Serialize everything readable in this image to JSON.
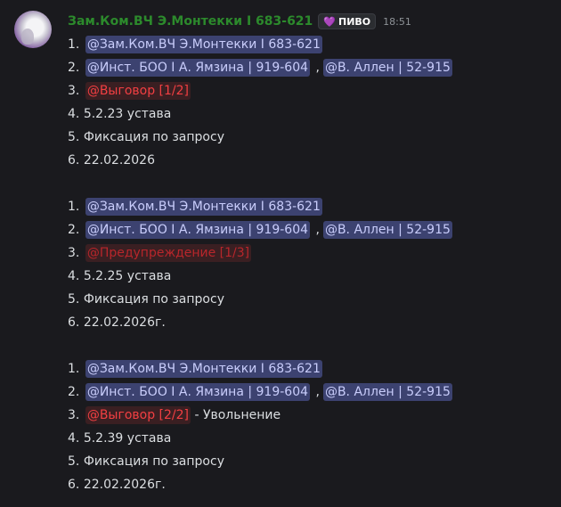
{
  "author": {
    "name": "Зам.Ком.ВЧ Э.Монтекки I 683-621",
    "badge_icon": "heart-icon",
    "badge_label": "ПИВО",
    "time": "18:51",
    "name_color": "#2c8a2c"
  },
  "blocks": [
    {
      "l1": {
        "num": "1.",
        "m1": "@Зам.Ком.ВЧ Э.Монтекки I 683-621"
      },
      "l2": {
        "num": "2.",
        "m1": "@Инст. БОО I А. Ямзина | 919-604",
        "sep": ",",
        "m2": "@В. Аллен | 52-915"
      },
      "l3": {
        "num": "3.",
        "m1": "@Выговор [1/2]",
        "suffix": ""
      },
      "l4": {
        "num": "4.",
        "text": "5.2.23 устава"
      },
      "l5": {
        "num": "5.",
        "text": "Фиксация по запросу"
      },
      "l6": {
        "num": "6.",
        "text": "22.02.2026"
      }
    },
    {
      "l1": {
        "num": "1.",
        "m1": "@Зам.Ком.ВЧ Э.Монтекки I 683-621"
      },
      "l2": {
        "num": "2.",
        "m1": "@Инст. БОО I А. Ямзина | 919-604",
        "sep": ",",
        "m2": "@В. Аллен | 52-915"
      },
      "l3": {
        "num": "3.",
        "m1": "@Предупреждение [1/3]",
        "suffix": ""
      },
      "l4": {
        "num": "4.",
        "text": "5.2.25 устава"
      },
      "l5": {
        "num": "5.",
        "text": "Фиксация по запросу"
      },
      "l6": {
        "num": "6.",
        "text": "22.02.2026г."
      }
    },
    {
      "l1": {
        "num": "1.",
        "m1": "@Зам.Ком.ВЧ Э.Монтекки I 683-621"
      },
      "l2": {
        "num": "2.",
        "m1": "@Инст. БОО I А. Ямзина | 919-604",
        "sep": ",",
        "m2": "@В. Аллен | 52-915"
      },
      "l3": {
        "num": "3.",
        "m1": "@Выговор [2/2]",
        "suffix": "- Увольнение"
      },
      "l4": {
        "num": "4.",
        "text": "5.2.39 устава"
      },
      "l5": {
        "num": "5.",
        "text": "Фиксация по запросу"
      },
      "l6": {
        "num": "6.",
        "text": "22.02.2026г."
      }
    }
  ]
}
